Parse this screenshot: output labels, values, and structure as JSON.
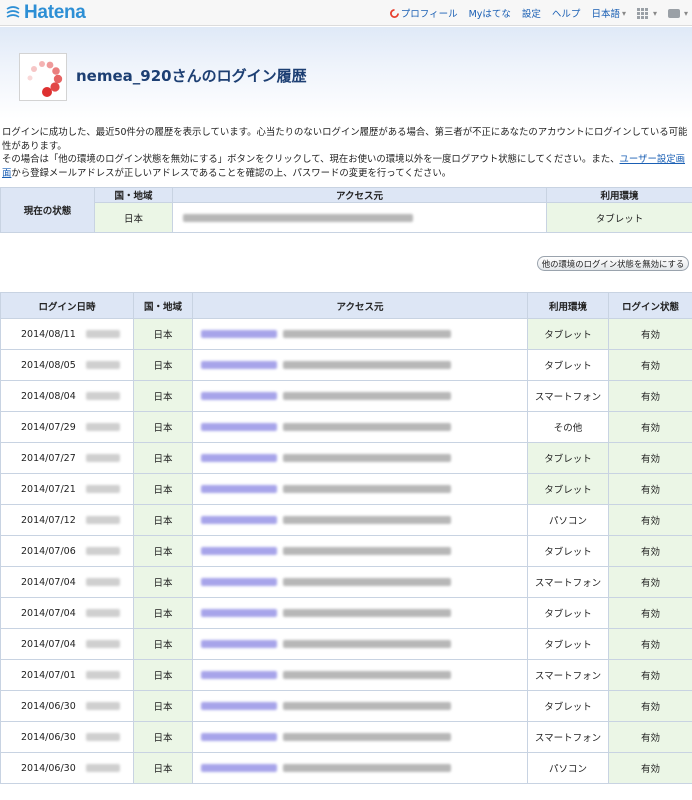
{
  "brand": {
    "logo_text": "Hatena",
    "logo_color": "#2d8fd5"
  },
  "topnav": {
    "profile": "プロフィール",
    "my_hatena": "Myはてな",
    "settings": "設定",
    "help": "ヘルプ",
    "language": "日本語"
  },
  "header": {
    "title": "nemea_920さんのログイン履歴"
  },
  "description": {
    "line1": "ログインに成功した、最近50件分の履歴を表示しています。心当たりのないログイン履歴がある場合、第三者が不正にあなたのアカウントにログインしている可能性があります。",
    "line2_pre": "その場合は「他の環境のログイン状態を無効にする」ボタンをクリックして、現在お使いの環境以外を一度ログアウト状態にしてください。また、",
    "line2_link": "ユーザー設定画面",
    "line2_post": "から登録メールアドレスが正しいアドレスであることを確認の上、パスワードの変更を行ってください。"
  },
  "current_status": {
    "label": "現在の状態",
    "headers": {
      "country": "国・地域",
      "source": "アクセス元",
      "env": "利用環境"
    },
    "row": {
      "country": "日本",
      "env": "タブレット"
    }
  },
  "invalidate_button": "他の環境のログイン状態を無効にする",
  "history": {
    "headers": {
      "date": "ログイン日時",
      "country": "国・地域",
      "source": "アクセス元",
      "env": "利用環境",
      "status": "ログイン状態"
    },
    "rows": [
      {
        "date": "2014/08/11",
        "country": "日本",
        "env": "タブレット",
        "status": "有効"
      },
      {
        "date": "2014/08/05",
        "country": "日本",
        "env": "タブレット",
        "status": "有効"
      },
      {
        "date": "2014/08/04",
        "country": "日本",
        "env": "スマートフォン",
        "status": "有効"
      },
      {
        "date": "2014/07/29",
        "country": "日本",
        "env": "その他",
        "status": "有効"
      },
      {
        "date": "2014/07/27",
        "country": "日本",
        "env": "タブレット",
        "status": "有効"
      },
      {
        "date": "2014/07/21",
        "country": "日本",
        "env": "タブレット",
        "status": "有効"
      },
      {
        "date": "2014/07/12",
        "country": "日本",
        "env": "パソコン",
        "status": "有効"
      },
      {
        "date": "2014/07/06",
        "country": "日本",
        "env": "タブレット",
        "status": "有効"
      },
      {
        "date": "2014/07/04",
        "country": "日本",
        "env": "スマートフォン",
        "status": "有効"
      },
      {
        "date": "2014/07/04",
        "country": "日本",
        "env": "タブレット",
        "status": "有効"
      },
      {
        "date": "2014/07/04",
        "country": "日本",
        "env": "タブレット",
        "status": "有効"
      },
      {
        "date": "2014/07/01",
        "country": "日本",
        "env": "スマートフォン",
        "status": "有効"
      },
      {
        "date": "2014/06/30",
        "country": "日本",
        "env": "タブレット",
        "status": "有効"
      },
      {
        "date": "2014/06/30",
        "country": "日本",
        "env": "スマートフォン",
        "status": "有効"
      },
      {
        "date": "2014/06/30",
        "country": "日本",
        "env": "パソコン",
        "status": "有効"
      }
    ]
  }
}
